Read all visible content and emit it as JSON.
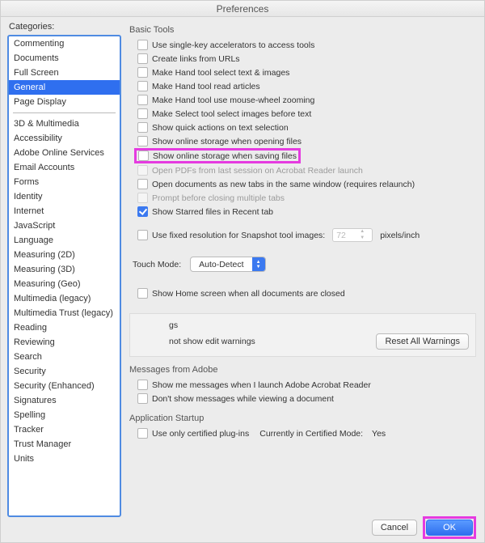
{
  "window_title": "Preferences",
  "sidebar": {
    "label": "Categories:",
    "group1": [
      "Commenting",
      "Documents",
      "Full Screen",
      "General",
      "Page Display"
    ],
    "selected": "General",
    "group2": [
      "3D & Multimedia",
      "Accessibility",
      "Adobe Online Services",
      "Email Accounts",
      "Forms",
      "Identity",
      "Internet",
      "JavaScript",
      "Language",
      "Measuring (2D)",
      "Measuring (3D)",
      "Measuring (Geo)",
      "Multimedia (legacy)",
      "Multimedia Trust (legacy)",
      "Reading",
      "Reviewing",
      "Search",
      "Security",
      "Security (Enhanced)",
      "Signatures",
      "Spelling",
      "Tracker",
      "Trust Manager",
      "Units"
    ]
  },
  "basic_tools": {
    "title": "Basic Tools",
    "items": [
      {
        "label": "Use single-key accelerators to access tools",
        "checked": false,
        "enabled": true
      },
      {
        "label": "Create links from URLs",
        "checked": false,
        "enabled": true
      },
      {
        "label": "Make Hand tool select text & images",
        "checked": false,
        "enabled": true
      },
      {
        "label": "Make Hand tool read articles",
        "checked": false,
        "enabled": true
      },
      {
        "label": "Make Hand tool use mouse-wheel zooming",
        "checked": false,
        "enabled": true
      },
      {
        "label": "Make Select tool select images before text",
        "checked": false,
        "enabled": true
      },
      {
        "label": "Show quick actions on text selection",
        "checked": false,
        "enabled": true
      },
      {
        "label": "Show online storage when opening files",
        "checked": false,
        "enabled": true
      },
      {
        "label": "Show online storage when saving files",
        "checked": false,
        "enabled": true,
        "highlighted": true
      },
      {
        "label": "Open PDFs from last session on Acrobat Reader launch",
        "checked": false,
        "enabled": false
      },
      {
        "label": "Open documents as new tabs in the same window (requires relaunch)",
        "checked": false,
        "enabled": true
      },
      {
        "label": "Prompt before closing multiple tabs",
        "checked": false,
        "enabled": false
      },
      {
        "label": "Show Starred files in Recent tab",
        "checked": true,
        "enabled": true
      }
    ],
    "snapshot": {
      "label": "Use fixed resolution for Snapshot tool images:",
      "value": "72",
      "unit": "pixels/inch"
    },
    "touch_mode": {
      "label": "Touch Mode:",
      "value": "Auto-Detect"
    },
    "home_screen": {
      "label": "Show Home screen when all documents are closed",
      "checked": false
    }
  },
  "warnings": {
    "frag1": "gs",
    "frag2": "not show edit warnings",
    "reset_btn": "Reset All Warnings"
  },
  "messages": {
    "title": "Messages from Adobe",
    "items": [
      {
        "label": "Show me messages when I launch Adobe Acrobat Reader",
        "checked": false
      },
      {
        "label": "Don't show messages while viewing a document",
        "checked": false
      }
    ]
  },
  "startup": {
    "title": "Application Startup",
    "cert_label": "Use only certified plug-ins",
    "cert_status_label": "Currently in Certified Mode:",
    "cert_status_value": "Yes"
  },
  "buttons": {
    "cancel": "Cancel",
    "ok": "OK"
  }
}
